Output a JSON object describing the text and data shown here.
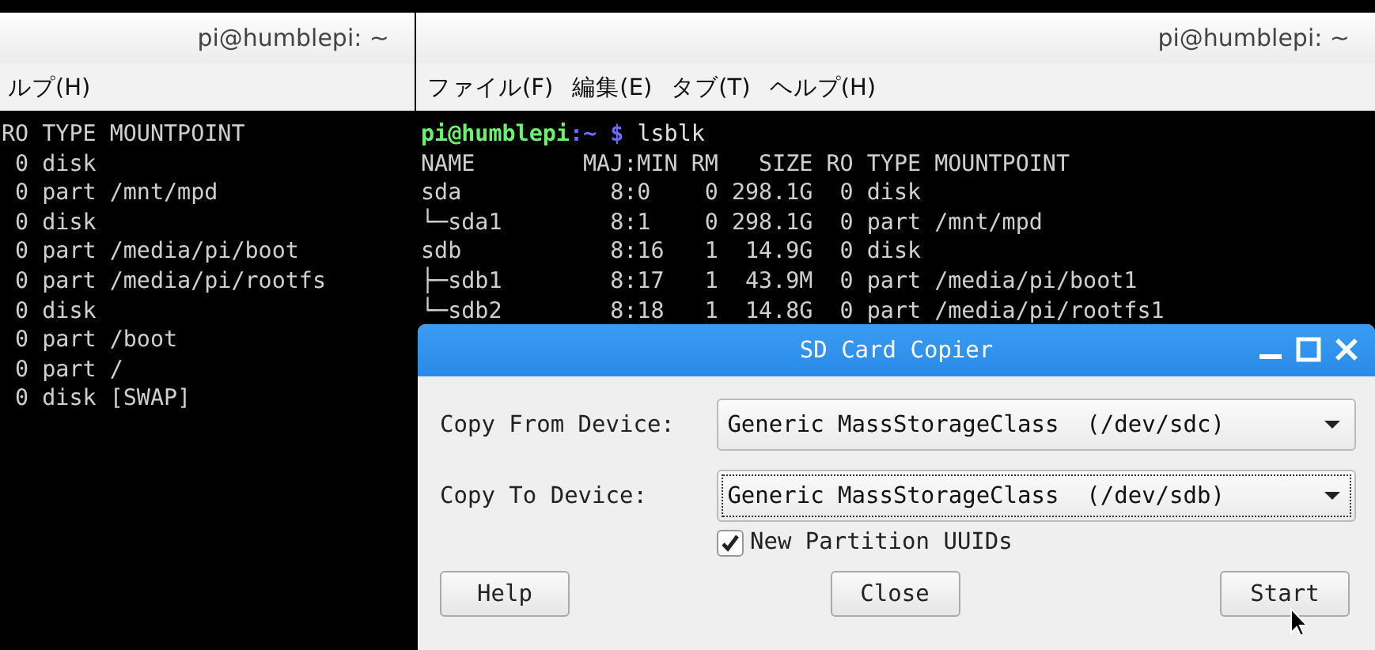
{
  "back_terminal": {
    "title": "pi@humblepi: ~",
    "menu": [
      "ルプ(H)"
    ],
    "output": [
      "RO TYPE MOUNTPOINT",
      " 0 disk",
      " 0 part /mnt/mpd",
      " 0 disk",
      " 0 part /media/pi/boot",
      " 0 part /media/pi/rootfs",
      " 0 disk",
      " 0 part /boot",
      " 0 part /",
      " 0 disk [SWAP]"
    ]
  },
  "front_terminal": {
    "title": "pi@humblepi: ~",
    "menu": [
      "ファイル(F)",
      "編集(E)",
      "タブ(T)",
      "ヘルプ(H)"
    ],
    "prompt": {
      "user": "pi@humblepi",
      "path": ":~",
      "symbol": "$",
      "command": "lsblk"
    },
    "output": [
      "NAME        MAJ:MIN RM   SIZE RO TYPE MOUNTPOINT",
      "sda           8:0    0 298.1G  0 disk",
      "└─sda1        8:1    0 298.1G  0 part /mnt/mpd",
      "sdb           8:16   1  14.9G  0 disk",
      "├─sdb1        8:17   1  43.9M  0 part /media/pi/boot1",
      "└─sdb2        8:18   1  14.8G  0 part /media/pi/rootfs1"
    ]
  },
  "dialog": {
    "title": "SD Card Copier",
    "fields": [
      {
        "label": "Copy From Device:",
        "value": "Generic MassStorageClass  (/dev/sdc)",
        "focused": false
      },
      {
        "label": "Copy To Device:",
        "value": "Generic MassStorageClass  (/dev/sdb)",
        "focused": true
      }
    ],
    "checkbox": {
      "label": "New Partition UUIDs",
      "checked": true
    },
    "buttons": [
      "Help",
      "Close",
      "Start"
    ]
  }
}
